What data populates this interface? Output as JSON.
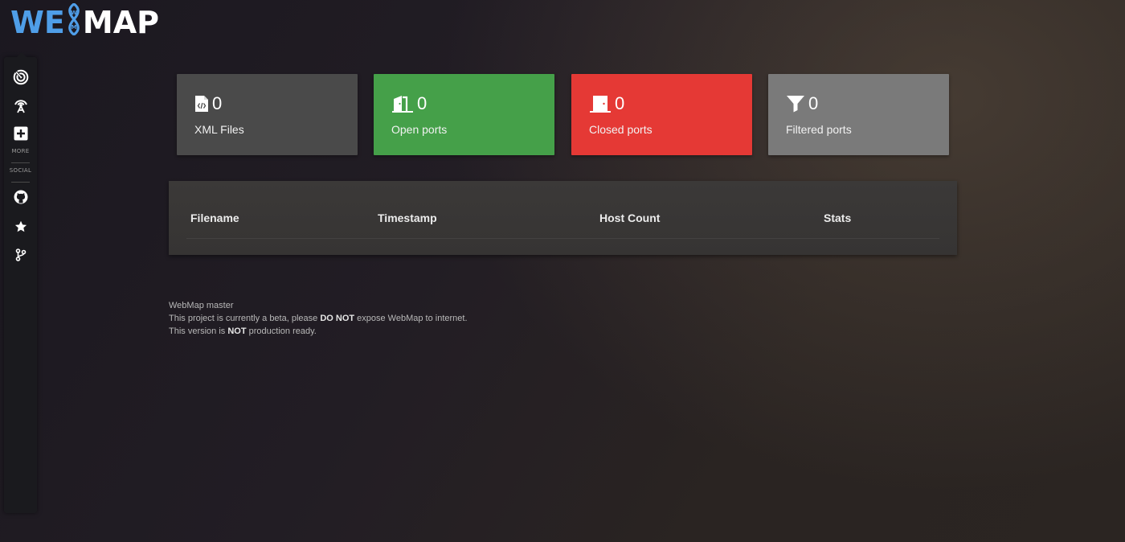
{
  "logo": {
    "left_text": "WE",
    "mark_letters": [
      "W",
      "M"
    ],
    "right_text": "MAP",
    "colors": {
      "we": "#4f9ee8",
      "map": "#ffffff"
    }
  },
  "sidebar": {
    "items": [
      {
        "name": "dashboard",
        "icon": "radar-icon"
      },
      {
        "name": "scan",
        "icon": "antenna-icon"
      },
      {
        "name": "more",
        "icon": "plus-square-icon"
      }
    ],
    "more_label": "MORE",
    "social_label": "SOCIAL",
    "social_items": [
      {
        "name": "github",
        "icon": "github-icon"
      },
      {
        "name": "star",
        "icon": "star-icon"
      },
      {
        "name": "fork",
        "icon": "code-branch-icon"
      }
    ]
  },
  "cards": [
    {
      "label": "XML Files",
      "count": "0",
      "icon": "file-code-icon",
      "color": "#4a4a4a"
    },
    {
      "label": "Open ports",
      "count": "0",
      "icon": "door-open-icon",
      "color": "#45a049"
    },
    {
      "label": "Closed ports",
      "count": "0",
      "icon": "door-closed-icon",
      "color": "#e53935"
    },
    {
      "label": "Filtered ports",
      "count": "0",
      "icon": "filter-icon",
      "color": "#7a7a7a"
    }
  ],
  "table": {
    "headers": [
      "Filename",
      "Timestamp",
      "Host Count",
      "Stats"
    ],
    "rows": []
  },
  "footer": {
    "line1": "WebMap master",
    "line2_pre": "This project is currently a beta, please ",
    "line2_bold": "DO NOT",
    "line2_post": " expose WebMap to internet.",
    "line3_pre": "This version is ",
    "line3_bold": "NOT",
    "line3_post": " production ready."
  }
}
